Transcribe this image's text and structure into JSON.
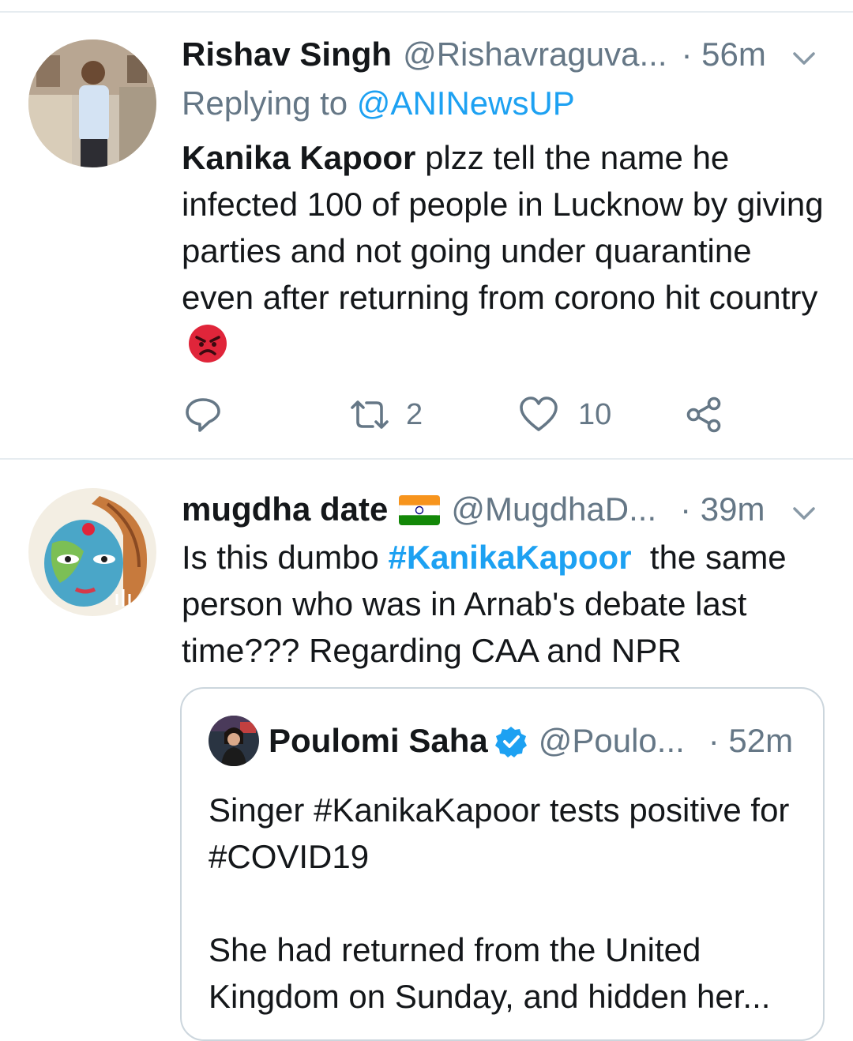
{
  "tweets": [
    {
      "name": "Rishav Singh",
      "handle": "@Rishavraguva...",
      "time": "· 56m",
      "replying_prefix": "Replying to ",
      "replying_to": "@ANINewsUP",
      "text_bold": "Kanika Kapoor",
      "text_rest": " plzz tell the name he infected 100 of people in Lucknow by giving parties and not going under quarantine even after returning from corono hit country",
      "emoji": "angry-face",
      "actions": {
        "reply_count": "",
        "retweet_count": "2",
        "like_count": "10"
      }
    },
    {
      "name": "mugdha date",
      "flag": "india-flag",
      "handle": "@MugdhaD...",
      "time": "· 39m",
      "text_before": "Is this dumbo ",
      "hashtag": "#KanikaKapoor",
      "text_after": "  the same person who was in Arnab's debate last time??? Regarding CAA and NPR",
      "quote": {
        "name": "Poulomi Saha",
        "verified": true,
        "handle": "@Poulo...",
        "time": "· 52m",
        "paragraph1": "Singer #KanikaKapoor tests positive for #COVID19",
        "paragraph2": "She had returned from the United Kingdom on Sunday, and hidden her..."
      }
    }
  ],
  "colors": {
    "link": "#1da1f2",
    "secondary": "#657786",
    "divider": "#e6ecf0",
    "border": "#ccd6dd"
  }
}
